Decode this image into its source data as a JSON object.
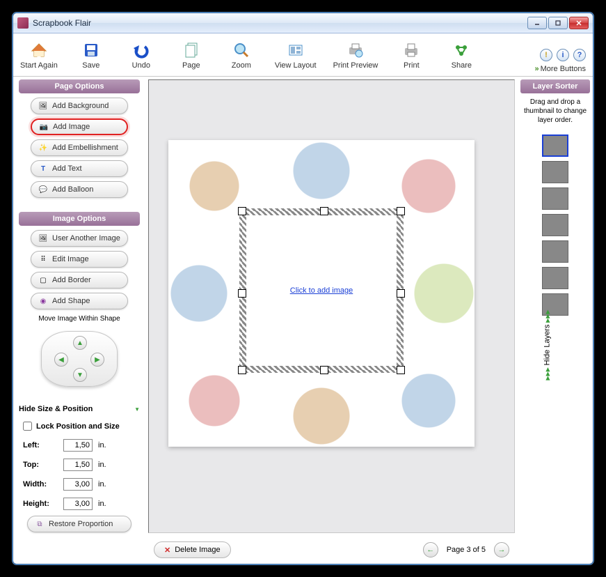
{
  "window": {
    "title": "Scrapbook Flair"
  },
  "toolbar": {
    "start_again": "Start Again",
    "save": "Save",
    "undo": "Undo",
    "page": "Page",
    "zoom": "Zoom",
    "view_layout": "View Layout",
    "print_preview": "Print Preview",
    "print": "Print",
    "share": "Share",
    "more_buttons": "More Buttons"
  },
  "page_options": {
    "header": "Page Options",
    "add_background": "Add Background",
    "add_image": "Add Image",
    "add_embellishment": "Add Embellishment",
    "add_text": "Add Text",
    "add_balloon": "Add Balloon"
  },
  "image_options": {
    "header": "Image Options",
    "use_another": "User Another Image",
    "edit_image": "Edit Image",
    "add_border": "Add Border",
    "add_shape": "Add Shape",
    "move_within": "Move Image Within Shape"
  },
  "size_position": {
    "header": "Hide Size & Position",
    "lock_label": "Lock Position and Size",
    "lock_checked": false,
    "left_label": "Left:",
    "left": "1,50",
    "top_label": "Top:",
    "top": "1,50",
    "width_label": "Width:",
    "width": "3,00",
    "height_label": "Height:",
    "height": "3,00",
    "unit": "in.",
    "restore": "Restore Proportion"
  },
  "canvas": {
    "placeholder_link": "Click to add image",
    "delete_image": "Delete Image",
    "page_status": "Page 3 of 5"
  },
  "layers": {
    "header": "Layer Sorter",
    "hint": "Drag and drop a thumbnail to change layer order.",
    "hide": "Hide Layers",
    "count": 7
  }
}
